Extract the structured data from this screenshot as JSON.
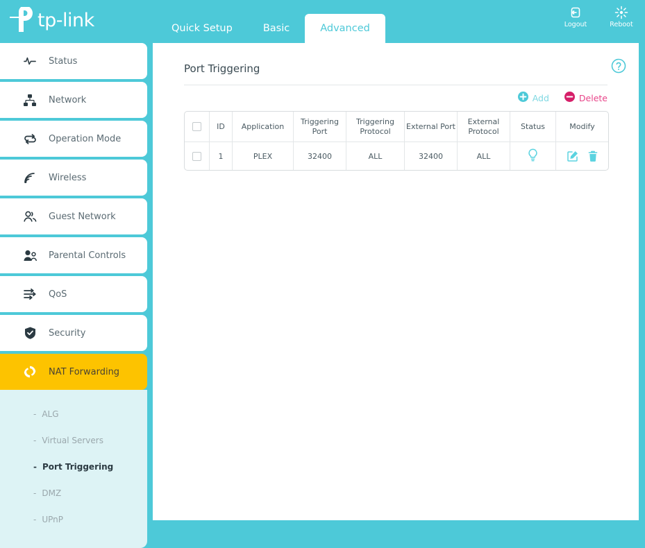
{
  "brand": {
    "name": "tp-link",
    "teal": "#4DC9D8",
    "amber": "#FDC300",
    "delete_pink": "#e8468a"
  },
  "header": {
    "tabs": [
      {
        "label": "Quick Setup",
        "active": false
      },
      {
        "label": "Basic",
        "active": false
      },
      {
        "label": "Advanced",
        "active": true
      }
    ],
    "actions": [
      {
        "label": "Logout",
        "icon": "logout-icon"
      },
      {
        "label": "Reboot",
        "icon": "reboot-icon"
      }
    ]
  },
  "sidebar": {
    "items": [
      {
        "label": "Status",
        "icon": "pulse-icon",
        "active": false
      },
      {
        "label": "Network",
        "icon": "network-tree-icon",
        "active": false
      },
      {
        "label": "Operation Mode",
        "icon": "swap-arrows-icon",
        "active": false
      },
      {
        "label": "Wireless",
        "icon": "wifi-icon",
        "active": false
      },
      {
        "label": "Guest Network",
        "icon": "people-icon",
        "active": false
      },
      {
        "label": "Parental Controls",
        "icon": "parent-child-icon",
        "active": false
      },
      {
        "label": "QoS",
        "icon": "sliders-icon",
        "active": false
      },
      {
        "label": "Security",
        "icon": "shield-check-icon",
        "active": false
      },
      {
        "label": "NAT Forwarding",
        "icon": "refresh-cycle-icon",
        "active": true
      }
    ],
    "submenu": [
      {
        "label": "ALG",
        "active": false
      },
      {
        "label": "Virtual Servers",
        "active": false
      },
      {
        "label": "Port Triggering",
        "active": true
      },
      {
        "label": "DMZ",
        "active": false
      },
      {
        "label": "UPnP",
        "active": false
      }
    ],
    "dash": "-"
  },
  "main": {
    "title": "Port Triggering",
    "help_icon": "help-circle-icon",
    "toolbar": {
      "add_label": "Add",
      "delete_label": "Delete",
      "add_icon": "plus-circle-icon",
      "delete_icon": "minus-circle-icon"
    },
    "table": {
      "columns": [
        "",
        "ID",
        "Application",
        "Triggering Port",
        "Triggering Protocol",
        "External Port",
        "External Protocol",
        "Status",
        "Modify"
      ],
      "rows": [
        {
          "id": "1",
          "application": "PLEX",
          "triggering_port": "32400",
          "triggering_protocol": "ALL",
          "external_port": "32400",
          "external_protocol": "ALL",
          "status_icon": "lightbulb-icon",
          "edit_icon": "edit-square-icon",
          "delete_icon": "trash-icon"
        }
      ]
    }
  }
}
